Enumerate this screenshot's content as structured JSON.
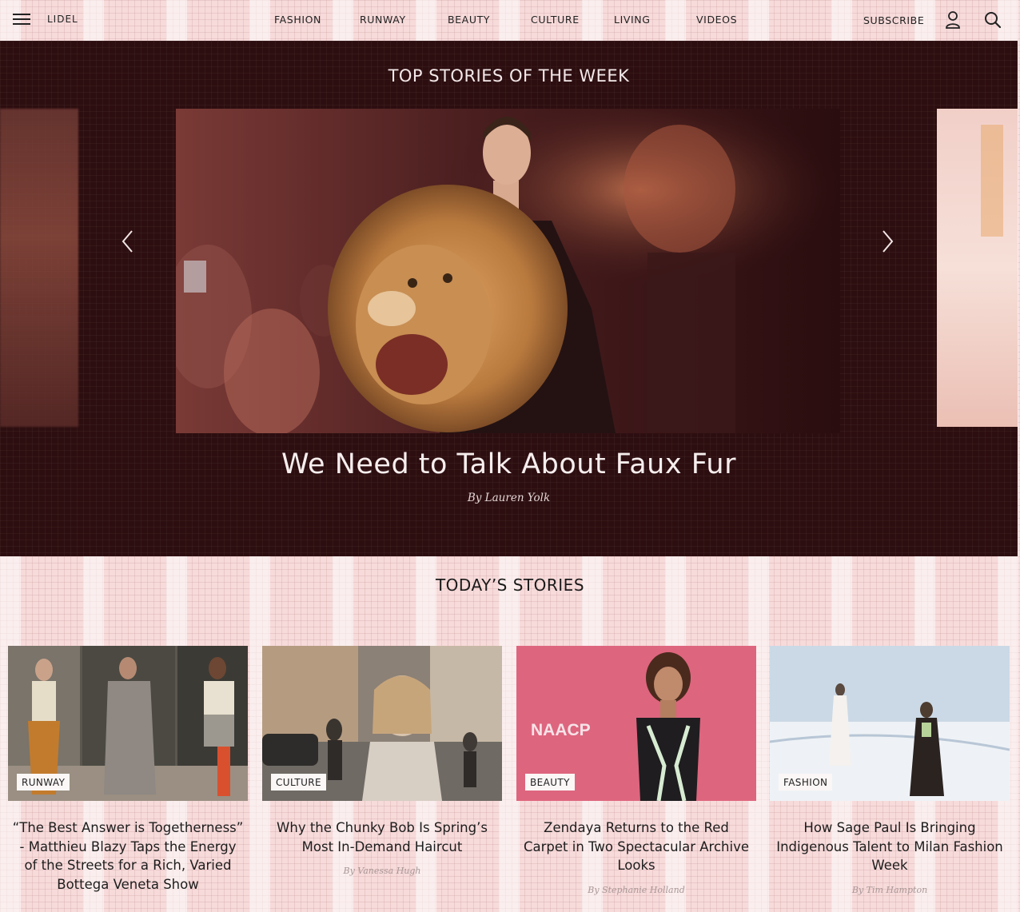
{
  "header": {
    "logo": "LIDEL",
    "nav": [
      "FASHION",
      "RUNWAY",
      "BEAUTY",
      "CULTURE",
      "LIVING",
      "VIDEOS"
    ],
    "subscribe": "SUBSCRIBE"
  },
  "hero": {
    "section_title": "TOP STORIES OF THE WEEK",
    "headline": "We Need to Talk About Faux Fur",
    "byline": "By Lauren Yolk"
  },
  "today": {
    "section_title": "TODAY’S STORIES",
    "cards": [
      {
        "tag": "RUNWAY",
        "title": "“The Best Answer is Togetherness” - Matthieu Blazy Taps the Energy of the Streets for a Rich, Varied Bottega Veneta Show",
        "author": ""
      },
      {
        "tag": "CULTURE",
        "title": "Why the Chunky Bob Is Spring’s Most In-Demand Haircut",
        "author": "By Vanessa Hugh"
      },
      {
        "tag": "BEAUTY",
        "title": "Zendaya Returns to the Red Carpet in Two Spectacular Archive Looks",
        "author": "By Stephanie Holland"
      },
      {
        "tag": "FASHION",
        "title": "How Sage Paul Is Bringing Indigenous Talent to Milan Fashion Week",
        "author": "By Tim Hampton"
      }
    ]
  },
  "photo_text": {
    "naacp": "NAACP"
  },
  "colors": {
    "page_bg": "#f7dada",
    "hero_bg": "#2d0e10",
    "hero_text": "#f4e9ea"
  },
  "icons": [
    "menu-icon",
    "user-icon",
    "search-icon",
    "chevron-left-icon",
    "chevron-right-icon"
  ]
}
